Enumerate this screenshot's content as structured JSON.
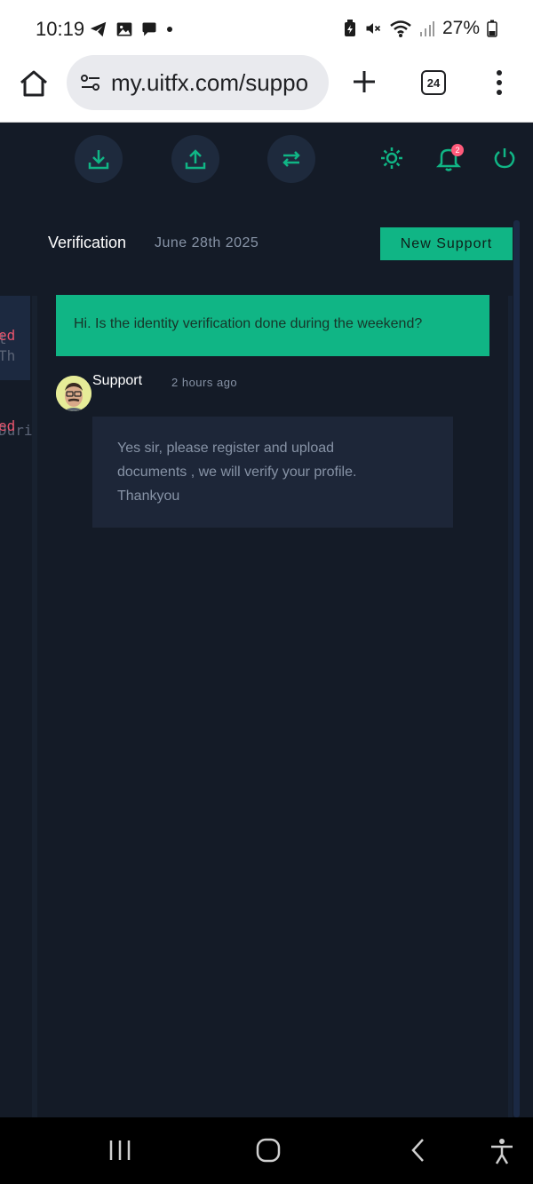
{
  "status_bar": {
    "time": "10:19",
    "battery": "27%"
  },
  "browser": {
    "url": "my.uitfx.com/suppo",
    "tab_count": "24"
  },
  "topnav": {
    "notification_count": "2",
    "icons": [
      "download-icon",
      "upload-icon",
      "transfer-icon",
      "sun-icon",
      "bell-icon",
      "power-icon"
    ],
    "accent_color": "#10b585"
  },
  "ticket": {
    "title": "Verification",
    "date": "June 28th 2025",
    "new_support_label": "New Support"
  },
  "side_list": {
    "items": [
      {
        "status": "ed",
        "preview": "t Th"
      },
      {
        "status": "ed",
        "preview": "Duri"
      }
    ]
  },
  "messages": {
    "user_message": "Hi. Is the identity verification done during the weekend?",
    "reply": {
      "sender": "Support",
      "time": "2 hours ago",
      "lines": [
        "Yes sir, please register and upload",
        "documents , we will verify your profile.",
        "Thankyou"
      ]
    }
  }
}
